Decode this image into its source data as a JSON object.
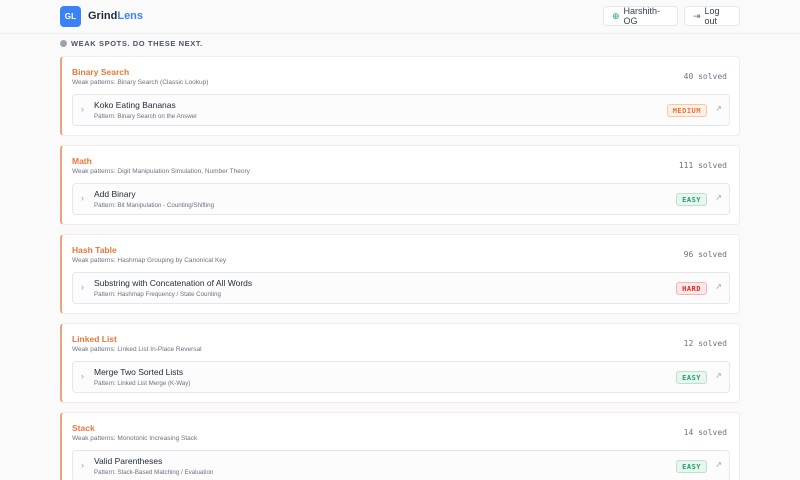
{
  "app": {
    "logo_text": "GL",
    "brand_part1": "Grind",
    "brand_part2": "Lens"
  },
  "header": {
    "user_label": "Harshith-OG",
    "user_icon": "globe-icon",
    "logout_label": "Log out",
    "logout_icon": "logout-icon"
  },
  "section": {
    "title": "WEAK SPOTS. DO THESE NEXT."
  },
  "colors": {
    "accent": "#3b82f6",
    "category": "#e8763b",
    "easy": "#22a06b",
    "medium": "#e8763b",
    "hard": "#dc2626"
  },
  "categories": [
    {
      "name": "Binary Search",
      "weak": "Weak patterns: Binary Search (Classic Lookup)",
      "solved": "40 solved",
      "problem": {
        "name": "Koko Eating Bananas",
        "pattern": "Pattern: Binary Search on the Answer",
        "difficulty": "MEDIUM"
      }
    },
    {
      "name": "Math",
      "weak": "Weak patterns: Digit Manipulation Simulation, Number Theory",
      "solved": "111 solved",
      "problem": {
        "name": "Add Binary",
        "pattern": "Pattern: Bit Manipulation - Counting/Shifting",
        "difficulty": "EASY"
      }
    },
    {
      "name": "Hash Table",
      "weak": "Weak patterns: Hashmap Grouping by Canonical Key",
      "solved": "96 solved",
      "problem": {
        "name": "Substring with Concatenation of All Words",
        "pattern": "Pattern: Hashmap Frequency / State Counting",
        "difficulty": "HARD"
      }
    },
    {
      "name": "Linked List",
      "weak": "Weak patterns: Linked List In-Place Reversal",
      "solved": "12 solved",
      "problem": {
        "name": "Merge Two Sorted Lists",
        "pattern": "Pattern: Linked List Merge (K-Way)",
        "difficulty": "EASY"
      }
    },
    {
      "name": "Stack",
      "weak": "Weak patterns: Monotonic Increasing Stack",
      "solved": "14 solved",
      "problem": {
        "name": "Valid Parentheses",
        "pattern": "Pattern: Stack-Based Matching / Evaluation",
        "difficulty": "EASY"
      }
    }
  ]
}
